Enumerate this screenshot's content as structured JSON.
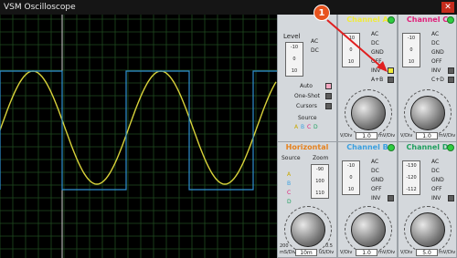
{
  "window": {
    "title": "VSM Oscilloscope",
    "close_glyph": "✕"
  },
  "callout": {
    "number": "1"
  },
  "trigger": {
    "level_label": "Level",
    "coupling": [
      "AC",
      "DC"
    ],
    "auto_label": "Auto",
    "oneshot_label": "One-Shot",
    "cursors_label": "Cursors",
    "source_label": "Source",
    "source_letters": [
      "A",
      "B",
      "C",
      "D"
    ],
    "slider_ticks": [
      "-10",
      "0",
      "10"
    ]
  },
  "channel_a": {
    "title": "Channel A",
    "options": [
      "AC",
      "DC",
      "GND",
      "OFF",
      "INV",
      "A+B"
    ],
    "ticks": [
      "-10",
      "0",
      "10"
    ],
    "readout": "1.0",
    "unit_left": "V/Div",
    "unit_right": "mV/Div",
    "color": "#f0ea3a"
  },
  "channel_c": {
    "title": "Channel C",
    "options": [
      "AC",
      "DC",
      "GND",
      "OFF",
      "INV",
      "C+D"
    ],
    "ticks": [
      "-10",
      "0",
      "10"
    ],
    "readout": "1.0",
    "unit_left": "V/Div",
    "unit_right": "mV/Div",
    "color": "#e0207a"
  },
  "horizontal": {
    "title": "Horizontal",
    "source_label": "Source",
    "zoom_label": "Zoom",
    "sources": [
      "A",
      "B",
      "C",
      "D"
    ],
    "ticks": [
      "-90",
      "100",
      "110"
    ],
    "readout": "10m",
    "unit_left": "mS/Div",
    "unit_right": "uS/Div",
    "scale": [
      "200",
      "0.5"
    ],
    "color": "#e6821e"
  },
  "channel_b": {
    "title": "Channel B",
    "options": [
      "AC",
      "DC",
      "GND",
      "OFF",
      "INV"
    ],
    "ticks": [
      "-10",
      "0",
      "10"
    ],
    "readout": "1.0",
    "unit_left": "V/Div",
    "unit_right": "mV/Div",
    "color": "#3aa0e0"
  },
  "channel_d": {
    "title": "Channel D",
    "options": [
      "AC",
      "DC",
      "GND",
      "OFF",
      "INV"
    ],
    "ticks": [
      "-130",
      "-120",
      "-112"
    ],
    "readout": "5.0",
    "unit_left": "V/Div",
    "unit_right": "mV/Div",
    "color": "#20a060"
  },
  "colors": {
    "screen": "#000000",
    "grid": "#1f5a1f",
    "trace_a": "#d8d23a",
    "trace_b": "#2f8fd0",
    "accent_callout": "#e8541f"
  }
}
